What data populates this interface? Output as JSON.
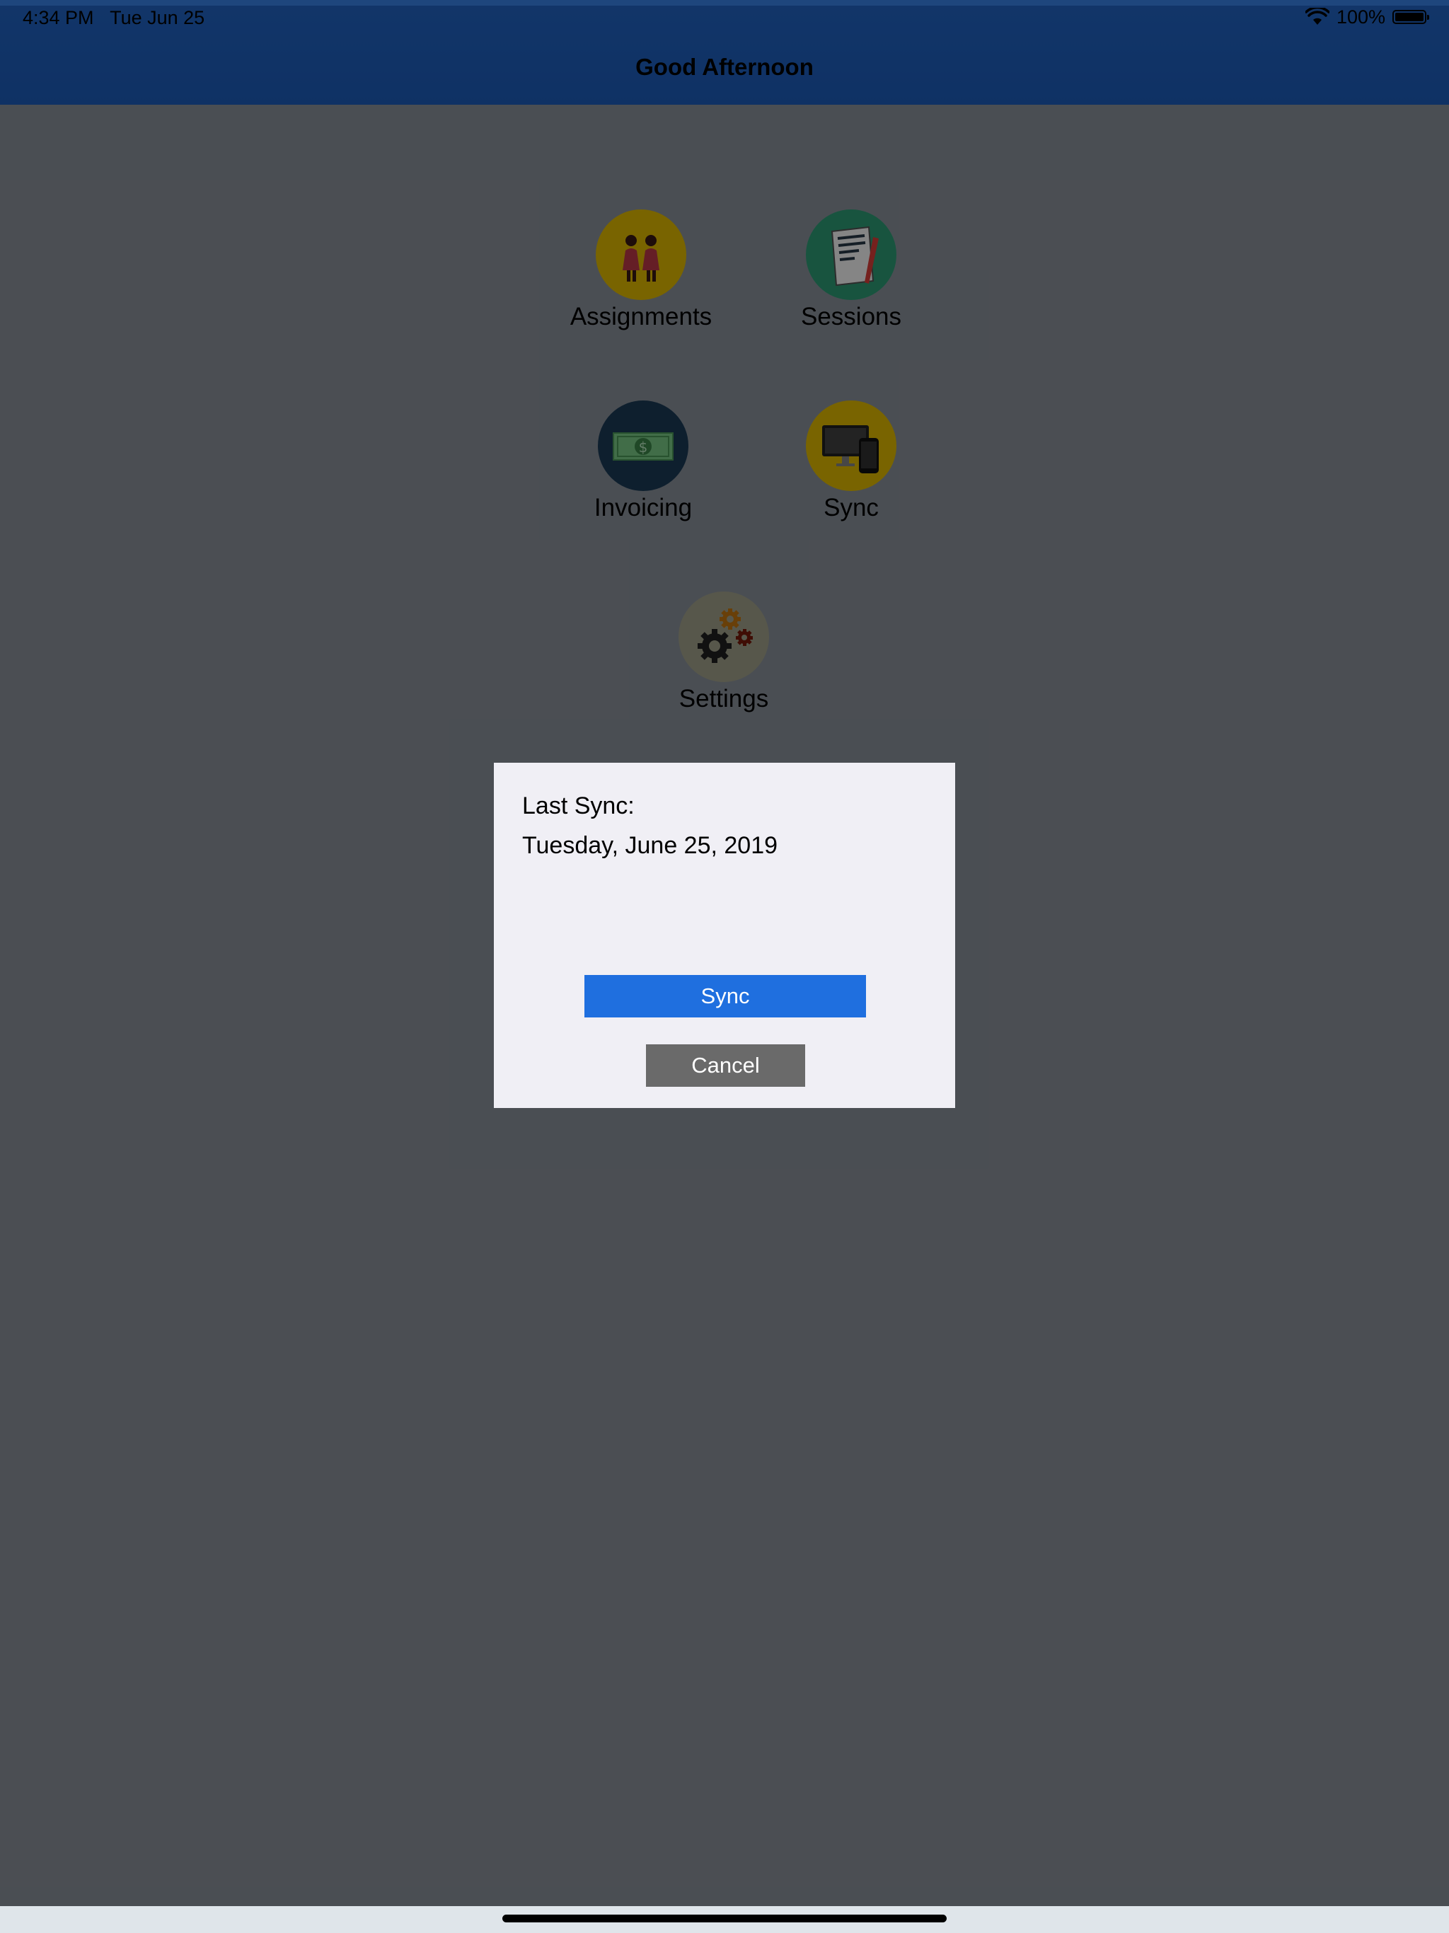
{
  "status_bar": {
    "time": "4:34 PM",
    "date": "Tue Jun 25",
    "battery_percent": "100%",
    "wifi_icon": "wifi-icon",
    "battery_icon": "battery-icon"
  },
  "nav": {
    "title": "Good Afternoon"
  },
  "menu": {
    "assignments": {
      "label": "Assignments",
      "icon": "people-icon",
      "color": "#e8c000"
    },
    "sessions": {
      "label": "Sessions",
      "icon": "notepad-icon",
      "color": "#2ea27a"
    },
    "invoicing": {
      "label": "Invoicing",
      "icon": "money-icon",
      "color": "#1b3c58"
    },
    "sync": {
      "label": "Sync",
      "icon": "devices-icon",
      "color": "#e8c000"
    },
    "settings": {
      "label": "Settings",
      "icon": "gears-icon",
      "color": "#a8a890"
    }
  },
  "dialog": {
    "label": "Last Sync:",
    "date": "Tuesday, June 25, 2019",
    "sync_label": "Sync",
    "cancel_label": "Cancel",
    "sync_color": "#1f6fdf",
    "cancel_color": "#6a6a6a"
  }
}
